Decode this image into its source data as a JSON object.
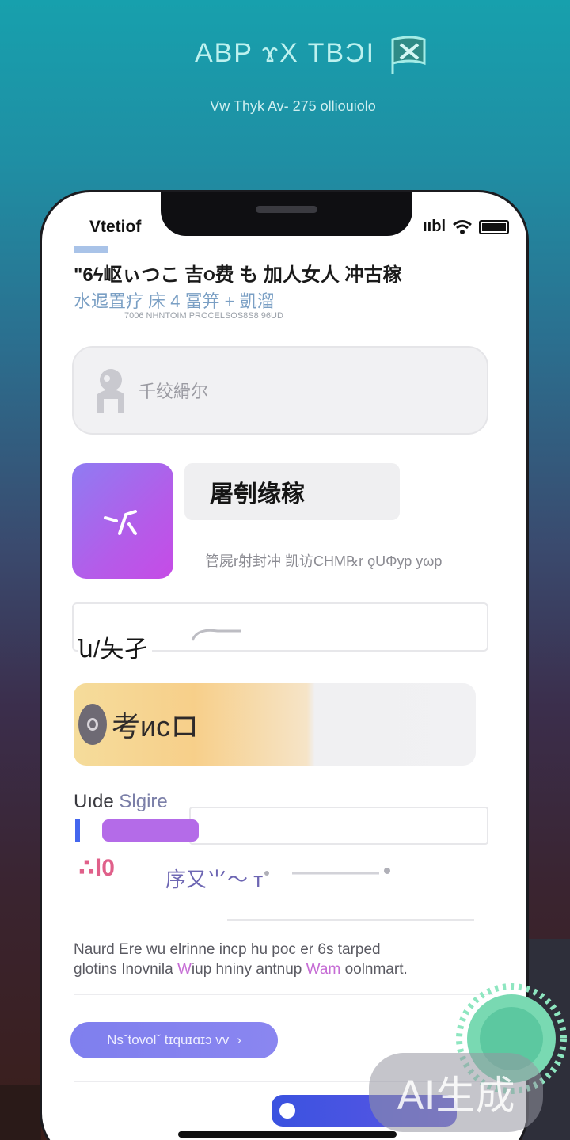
{
  "hero": {
    "title": "ABP ϫX TBƆI",
    "subtitle": "Vw Thyk Av- 275 olliouiolo"
  },
  "status_bar": {
    "carrier": "Vtetiof",
    "signal_text": "ııbl"
  },
  "header": {
    "line1": "\"6ϟ岖ぃつこ 吉૦费 も 加人女人 冲古稼",
    "line2": "水迡置疗 床 4 冨笄 + 凱溜",
    "line3": "7006 NHNTOIM PROCELSOS8S8 96UD"
  },
  "search_card": {
    "label": "千绞縎尔"
  },
  "app_card": {
    "title": "屠刳缘稼",
    "description": "管屍r射封冲 凯访CHM℞r ǫUΦур уωр"
  },
  "input_row": {
    "label": "ն/夨孑"
  },
  "warm_card": {
    "label": "考исロ"
  },
  "section": {
    "label_main": "Uıde",
    "label_tint": "Slgire"
  },
  "row3": {
    "badge": "∴l0",
    "text": "序又⺌〜 т"
  },
  "body_text": {
    "line1": "Naurd Ere wu elrinne incp hu poc er 6s tarped",
    "line2_a": "glotins Inovnila",
    "line2_accent": "W",
    "line2_b": "iup hniny antnup",
    "line2_accent2": "Wam",
    "line2_c": "oolnmart."
  },
  "action_button": {
    "label": "Nsˇtovolˇ tɪquɪɑɪɔ vv",
    "chevron": "›"
  },
  "watermark": {
    "label": "AI生成"
  },
  "icons": {
    "status": [
      "wifi-icon",
      "battery-icon"
    ],
    "search": "person-icon",
    "app": "sparkle-icon",
    "warm": "circle-icon",
    "logo": "flag-logo-icon"
  },
  "colors": {
    "background_top": "#17a0ad",
    "background_bottom": "#3a1e1a",
    "app_icon_start": "#8f7cf2",
    "app_icon_end": "#c64be6",
    "button": "#7f7fee",
    "toggle": "#3a52e0"
  }
}
